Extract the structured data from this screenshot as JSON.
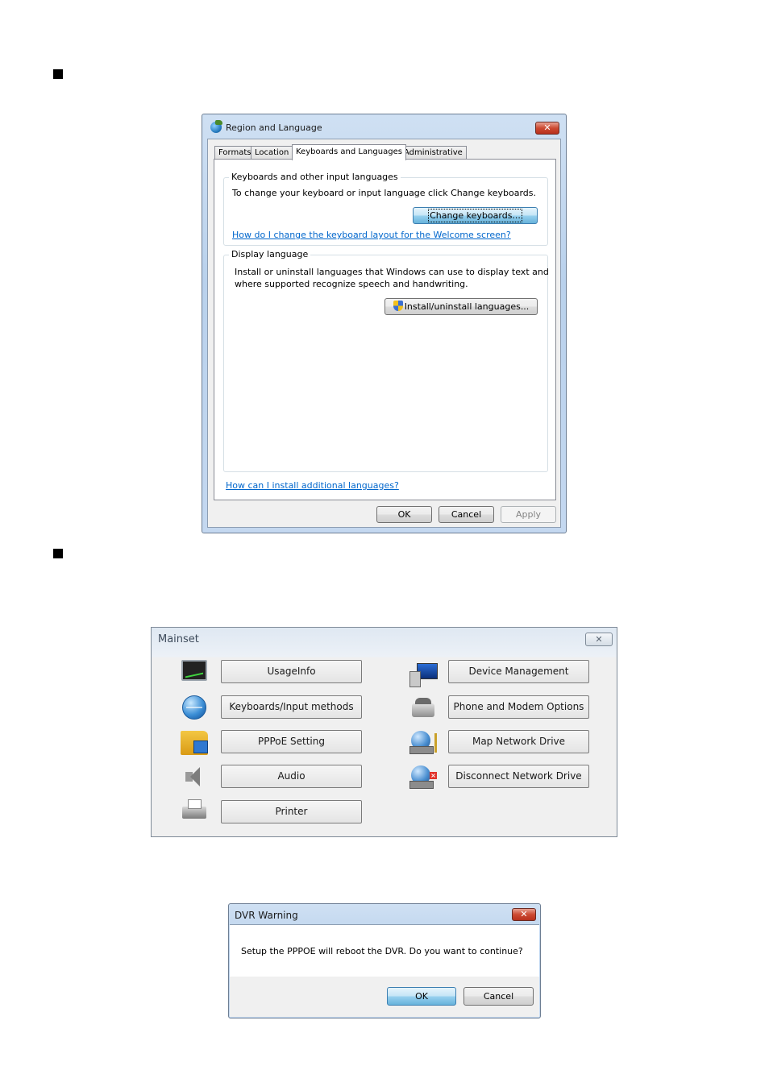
{
  "region_dialog": {
    "title": "Region and Language",
    "close_label": "✕",
    "tabs": [
      {
        "label": "Formats"
      },
      {
        "label": "Location"
      },
      {
        "label": "Keyboards and Languages"
      },
      {
        "label": "Administrative"
      }
    ],
    "keyboards_group": {
      "legend": "Keyboards and other input languages",
      "description": "To change your keyboard or input language click Change keyboards.",
      "button_label": "Change keyboards...",
      "link": "How do I change the keyboard layout for the Welcome screen?"
    },
    "display_group": {
      "legend": "Display language",
      "description_line1": "Install or uninstall languages that Windows can use to display text and",
      "description_line2": "where supported recognize speech and handwriting.",
      "button_label": "Install/uninstall languages..."
    },
    "bottom_link": "How can I install additional languages?",
    "footer": {
      "ok": "OK",
      "cancel": "Cancel",
      "apply": "Apply"
    }
  },
  "mainset_dialog": {
    "title": "Mainset",
    "close_label": "✕",
    "left_items": [
      {
        "label": "UsageInfo",
        "icon": "usage-monitor-icon"
      },
      {
        "label": "Keyboards/Input methods",
        "icon": "globe-icon"
      },
      {
        "label": "PPPoE Setting",
        "icon": "network-folder-icon"
      },
      {
        "label": "Audio",
        "icon": "speaker-icon"
      },
      {
        "label": "Printer",
        "icon": "printer-icon"
      }
    ],
    "right_items": [
      {
        "label": "Device Management",
        "icon": "device-manager-icon"
      },
      {
        "label": "Phone and Modem Options",
        "icon": "phone-modem-icon"
      },
      {
        "label": "Map Network Drive",
        "icon": "map-network-drive-icon"
      },
      {
        "label": "Disconnect Network Drive",
        "icon": "disconnect-network-drive-icon"
      }
    ]
  },
  "dvr_dialog": {
    "title": "DVR Warning",
    "close_label": "✕",
    "message": "Setup the PPPOE will reboot the DVR. Do you want to continue?",
    "ok": "OK",
    "cancel": "Cancel"
  }
}
